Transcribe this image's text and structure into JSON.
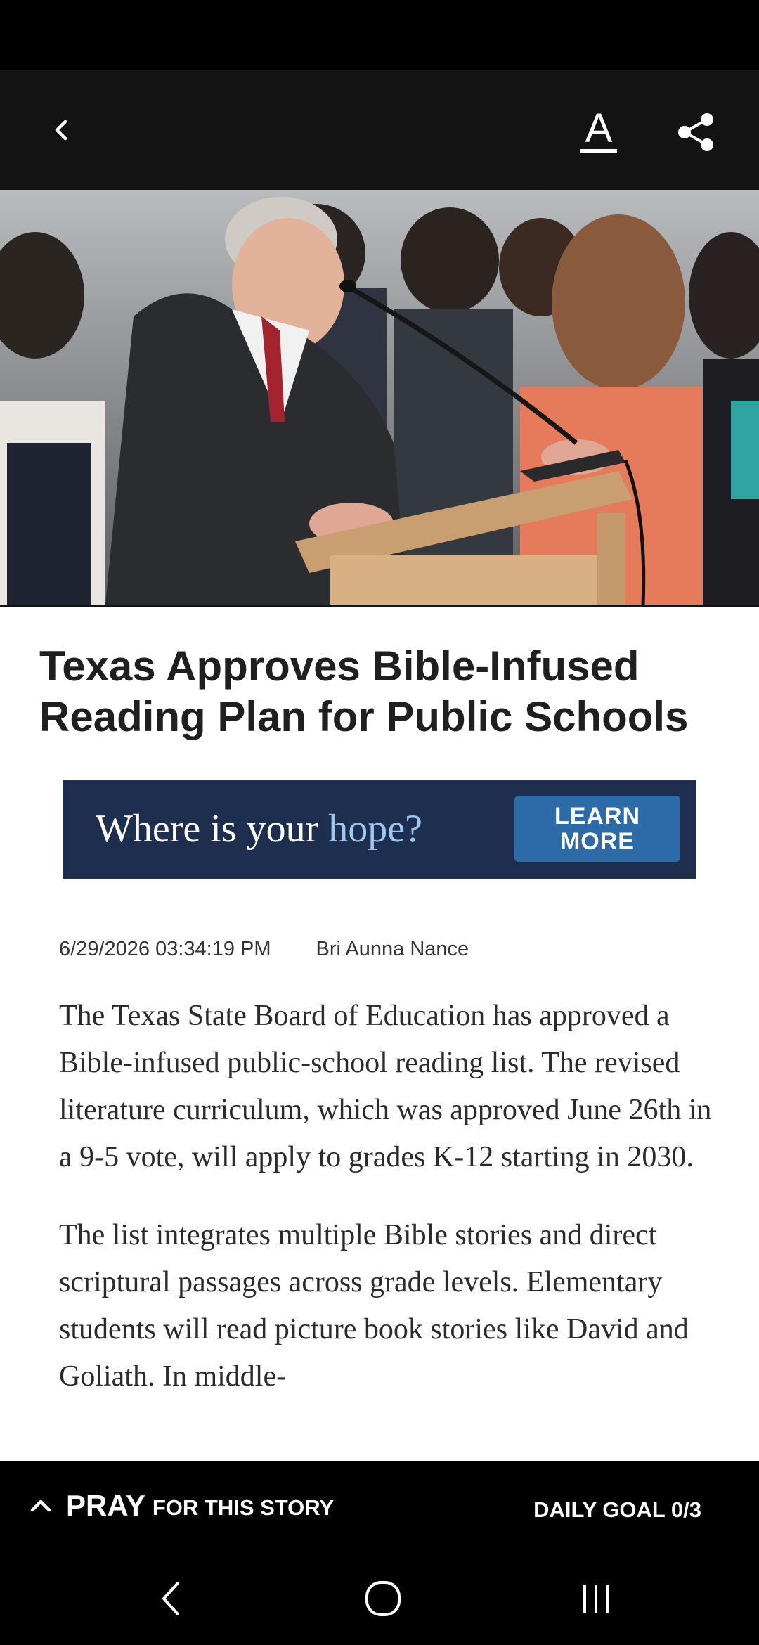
{
  "app_bar": {
    "back_icon": "chevron-left-icon",
    "font_icon": "text-size-icon",
    "font_glyph": "A",
    "share_icon": "share-icon"
  },
  "hero": {
    "icon": "article-photo"
  },
  "article": {
    "headline": "Texas Approves Bible-Infused Reading Plan for Public Schools",
    "ad": {
      "text_main": "Where is your ",
      "text_accent": "hope?",
      "cta_line1": "LEARN",
      "cta_line2": "MORE"
    },
    "meta": {
      "timestamp": "6/29/2026 03:34:19 PM",
      "author": "Bri Aunna Nance"
    },
    "paragraphs": [
      "The Texas State Board of Education has approved a Bible-infused public-school reading list. The revised literature curriculum, which was approved June 26th in a 9-5 vote, will apply to grades K-12 starting in 2030.",
      "The list integrates multiple Bible stories and direct scriptural passages across grade levels. Elementary students will read picture book stories like David and Goliath. In middle-"
    ]
  },
  "pray_bar": {
    "pray_word": "PRAY",
    "pray_rest": "FOR THIS STORY",
    "goal": "DAILY GOAL 0/3",
    "icon": "chevron-up-icon"
  },
  "nav_bar": {
    "back_icon": "nav-back-icon",
    "home_icon": "nav-home-icon",
    "recents_icon": "nav-recents-icon"
  },
  "colors": {
    "app_bar_bg": "#131313",
    "ad_bg": "#1e2e4f",
    "ad_accent": "#9cc7f3",
    "ad_cta_bg": "#2d6aa8",
    "pray_bar_bg": "#000000"
  }
}
